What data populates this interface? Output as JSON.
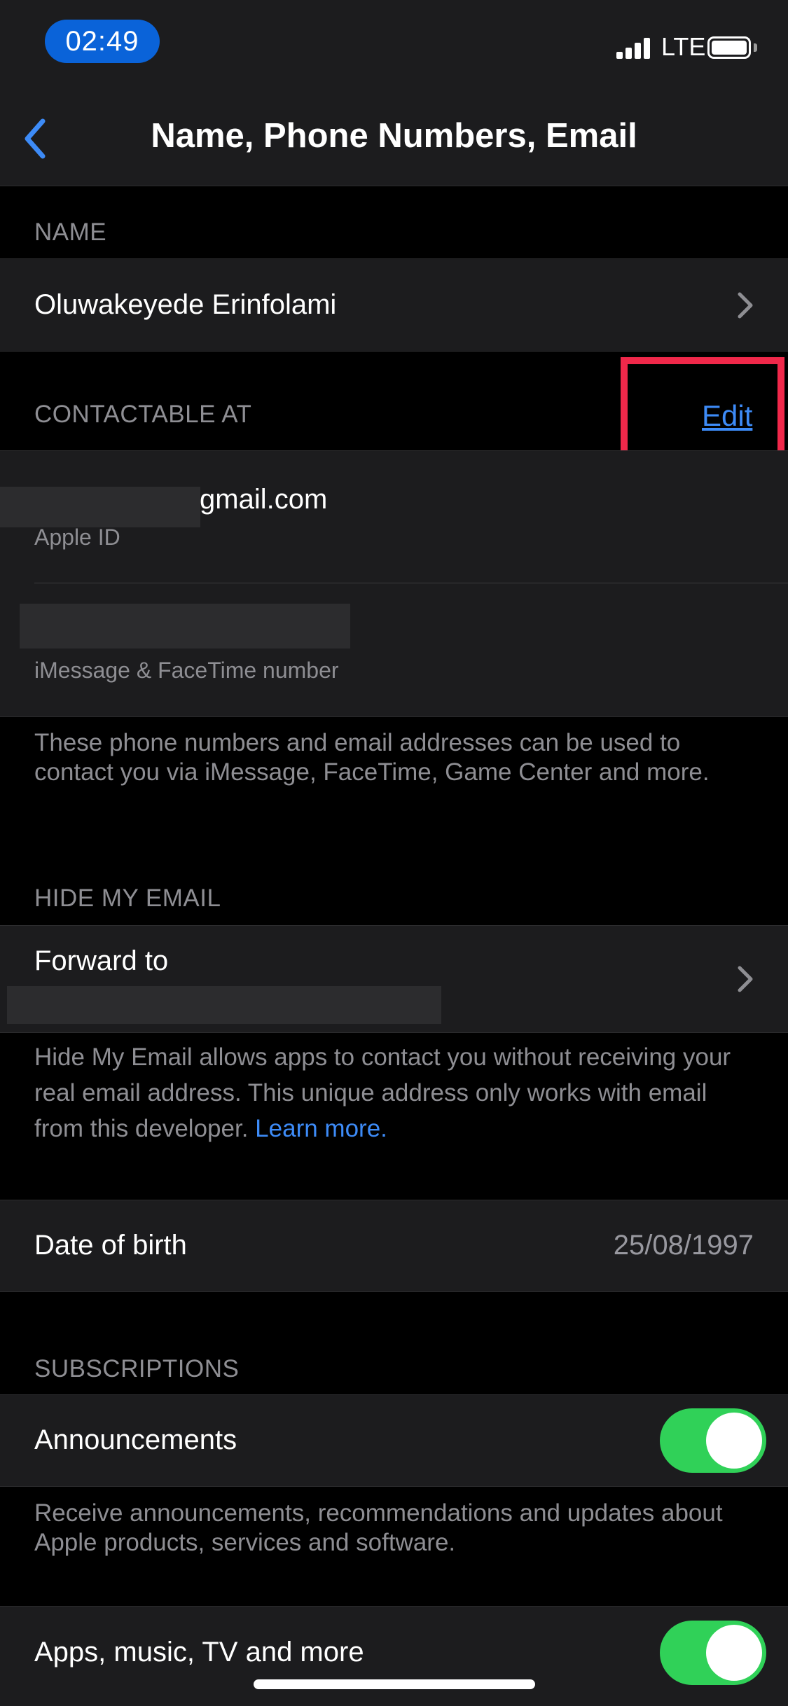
{
  "status_bar": {
    "time": "02:49",
    "network": "LTE",
    "signal_icon": "cellular-signal-icon",
    "battery_icon": "battery-icon"
  },
  "nav": {
    "title": "Name, Phone Numbers, Email",
    "back_icon": "chevron-left-icon"
  },
  "name_section": {
    "header": "NAME",
    "value": "Oluwakeyede Erinfolami"
  },
  "contactable_section": {
    "header": "CONTACTABLE AT",
    "edit_label": "Edit",
    "items": [
      {
        "value": "gmail.com",
        "subtitle": "Apple ID"
      },
      {
        "value": "",
        "subtitle": "iMessage & FaceTime number"
      }
    ],
    "footer": "These phone numbers and email addresses can be used to contact you via iMessage, FaceTime, Game Center and more."
  },
  "hide_my_email_section": {
    "header": "HIDE MY EMAIL",
    "forward_label": "Forward to",
    "footer": "Hide My Email allows apps to contact you without receiving your real email address. This unique address only works with email from this developer.",
    "learn_more": "Learn more."
  },
  "birth_section": {
    "label": "Date of birth",
    "value": "25/08/1997"
  },
  "subscriptions_section": {
    "header": "SUBSCRIPTIONS",
    "items": [
      {
        "label": "Announcements",
        "enabled": true,
        "footer": "Receive announcements, recommendations and updates about Apple products, services and software."
      },
      {
        "label": "Apps, music, TV and more",
        "enabled": true
      }
    ]
  },
  "colors": {
    "accent": "#3d8bf7",
    "toggle_on": "#30d158",
    "highlight": "#f0284a",
    "background": "#000000",
    "cell": "#1c1c1e"
  }
}
